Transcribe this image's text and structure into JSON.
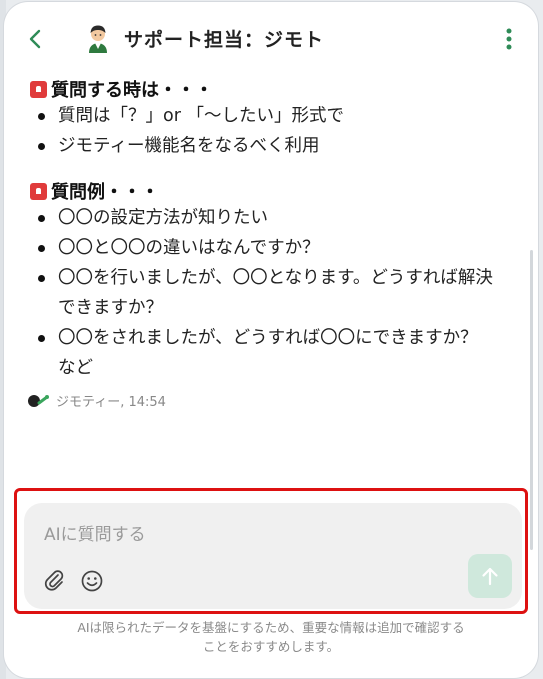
{
  "header": {
    "title": "サポート担当：ジモト"
  },
  "sections": [
    {
      "heading": "質問する時は・・・",
      "items": [
        "質問は「？」or 「〜したい」形式で",
        "ジモティー機能名をなるべく利用"
      ]
    },
    {
      "heading": "質問例・・・",
      "items": [
        "〇〇の設定方法が知りたい",
        "〇〇と〇〇の違いはなんですか？",
        "〇〇を行いましたが、〇〇となります。どうすれば解決できますか？",
        "〇〇をされましたが、どうすれば〇〇にできますか？　など"
      ]
    }
  ],
  "message_meta": {
    "sender_time": "ジモティー, 14:54"
  },
  "composer": {
    "placeholder": "AIに質問する"
  },
  "disclaimer": {
    "line1": "AIは限られたデータを基盤にするため、重要な情報は追加で確認する",
    "line2": "ことをおすすめします。"
  },
  "colors": {
    "accent_green": "#2e8b57",
    "send_button_bg": "#cfe8dc",
    "highlight_border": "#dd1111"
  },
  "icons": {
    "back": "chevron-left-icon",
    "menu": "kebab-menu-icon",
    "attach": "paperclip-icon",
    "emoji": "smiley-icon",
    "send": "arrow-up-icon",
    "heading": "siren-icon"
  }
}
